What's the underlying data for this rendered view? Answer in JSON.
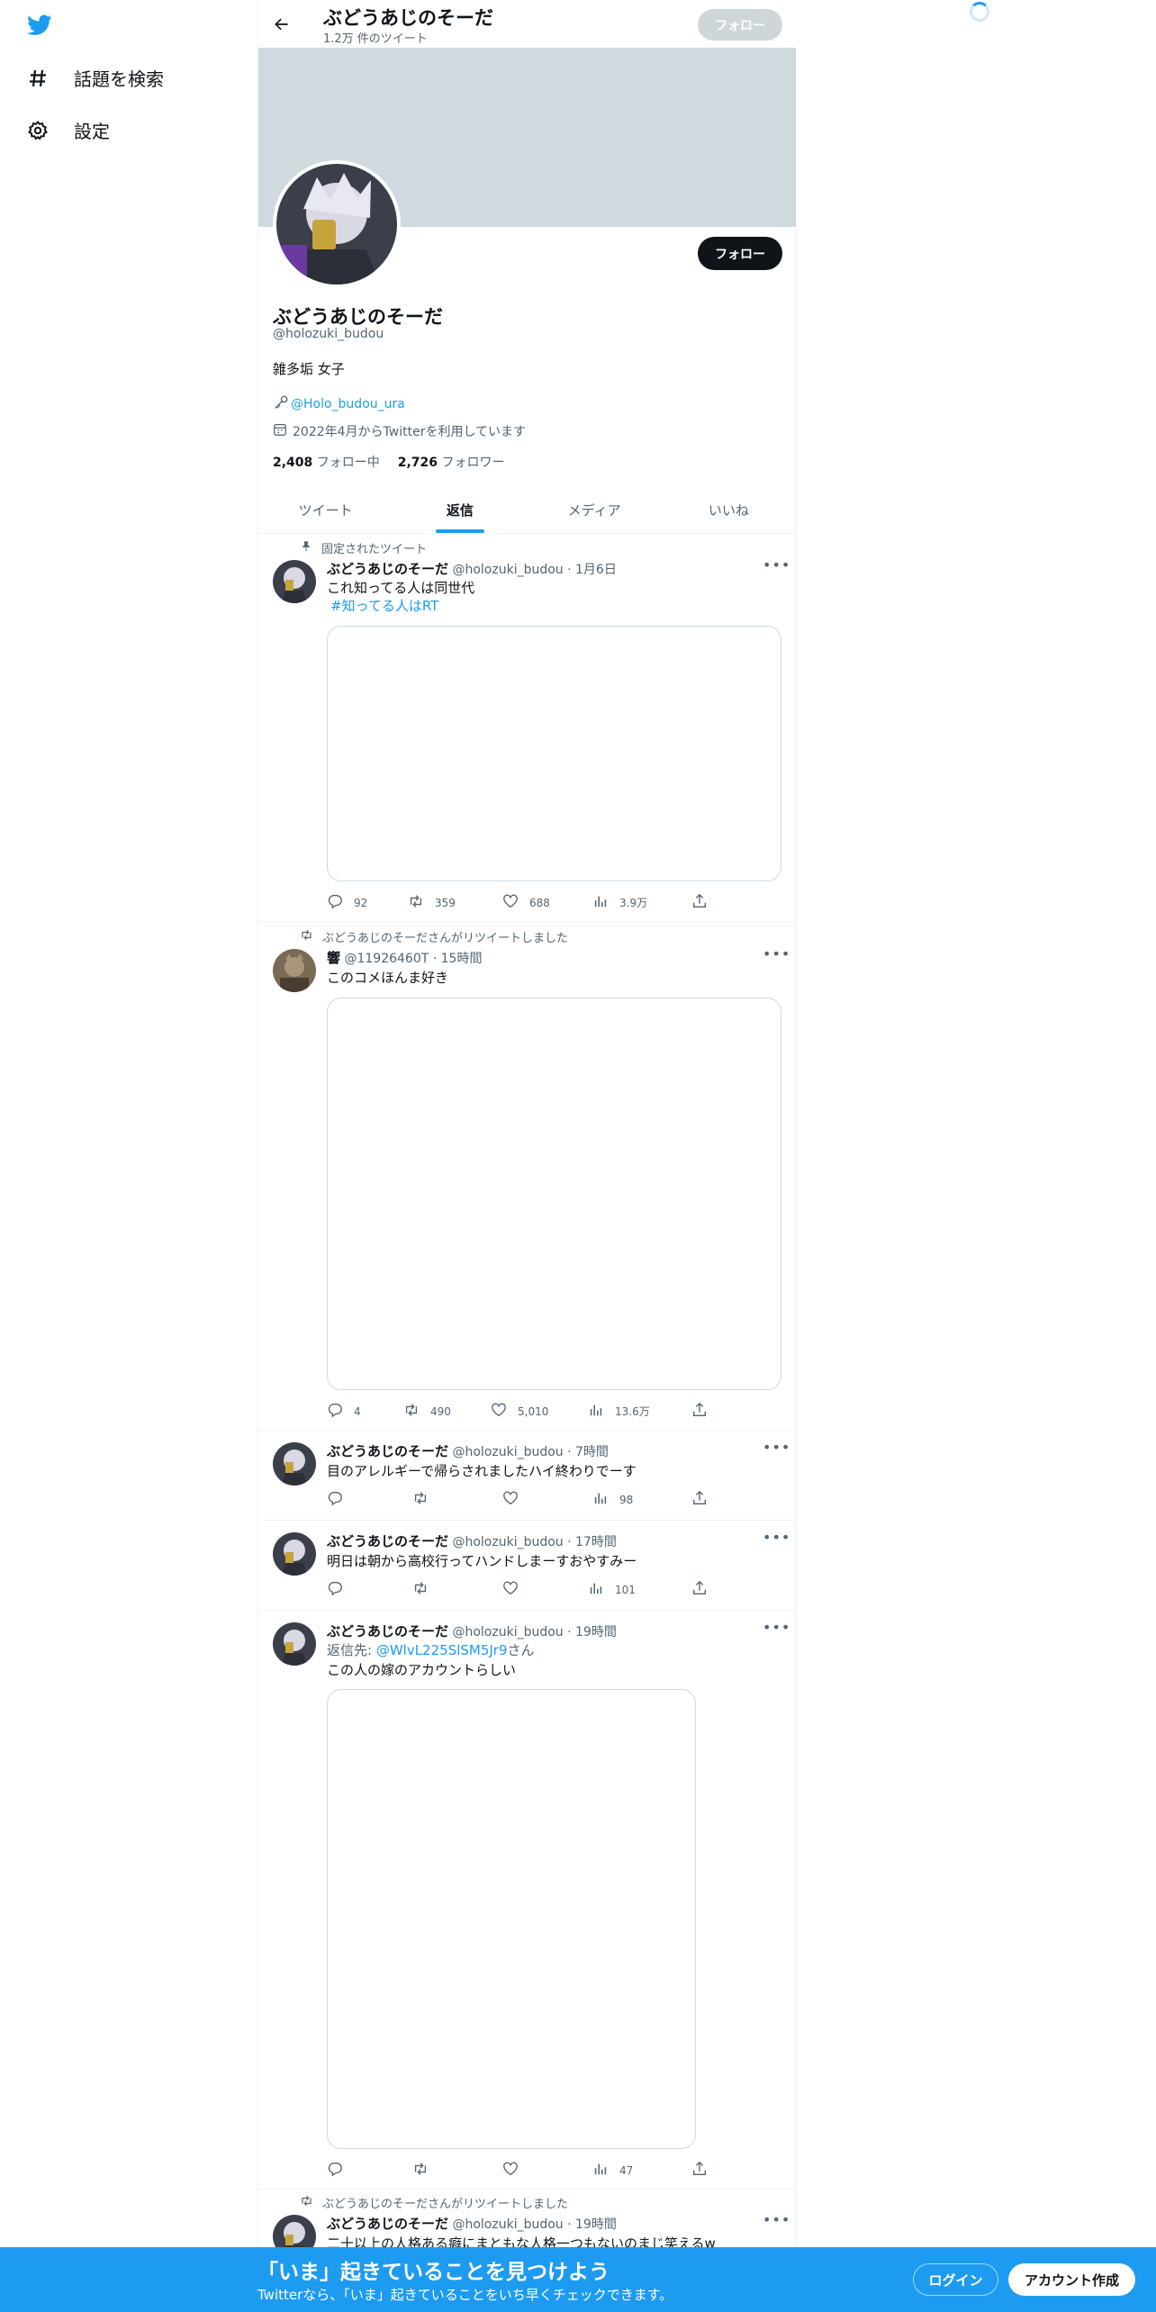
{
  "nav": {
    "explore_label": "話題を検索",
    "settings_label": "設定"
  },
  "header": {
    "name": "ぶどうあじのそーだ",
    "tweet_count": "1.2万 件のツイート",
    "follow_label": "フォロー"
  },
  "profile": {
    "follow_label": "フォロー",
    "name": "ぶどうあじのそーだ",
    "handle": "@holozuki_budou",
    "bio": "雑多垢 女子",
    "link": "@Holo_budou_ura",
    "joined": "2022年4月からTwitterを利用しています",
    "following_count": "2,408",
    "following_label": "フォロー中",
    "followers_count": "2,726",
    "followers_label": "フォロワー"
  },
  "tabs": [
    "ツイート",
    "返信",
    "メディア",
    "いいね"
  ],
  "tweets": [
    {
      "context": "固定されたツイート",
      "name": "ぶどうあじのそーだ",
      "meta": "@holozuki_budou · 1月6日",
      "text": "これ知ってる人は同世代",
      "tag": "#知ってる人はRT",
      "replies": "92",
      "retweets": "359",
      "likes": "688",
      "views": "3.9万"
    },
    {
      "context": "ぶどうあじのそーださんがリツイートしました",
      "name": "響",
      "meta": "@11926460T · 15時間",
      "text": "このコメほんま好き",
      "replies": "4",
      "retweets": "490",
      "likes": "5,010",
      "views": "13.6万"
    },
    {
      "name": "ぶどうあじのそーだ",
      "meta": "@holozuki_budou · 7時間",
      "text": "目のアレルギーで帰らされましたハイ終わりでーす",
      "views": "98"
    },
    {
      "name": "ぶどうあじのそーだ",
      "meta": "@holozuki_budou · 17時間",
      "text": "明日は朝から高校行ってハンドしまーすおやすみー",
      "views": "101"
    },
    {
      "name": "ぶどうあじのそーだ",
      "meta": "@holozuki_budou · 19時間",
      "reply_prefix": "返信先: ",
      "reply_to": "@WlvL225SlSM5Jr9",
      "reply_suffix": "さん",
      "text": "この人の嫁のアカウントらしい",
      "views": "47"
    },
    {
      "context": "ぶどうあじのそーださんがリツイートしました",
      "name": "ぶどうあじのそーだ",
      "meta": "@holozuki_budou · 19時間",
      "text": "二十以上の人格ある癖にまともな人格一つもないのまじ笑えるw"
    }
  ],
  "bottom_bar": {
    "title": "「いま」起きていることを見つけよう",
    "subtitle": "Twitterなら、「いま」起きていることをいち早くチェックできます。",
    "login_label": "ログイン",
    "signup_label": "アカウント作成"
  },
  "colors": {
    "accent": "#1d9bf0",
    "text": "#0f1419",
    "muted": "#536471"
  }
}
